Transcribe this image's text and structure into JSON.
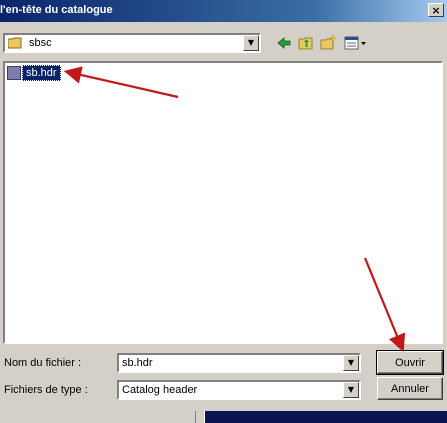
{
  "window": {
    "title": "l'en-tête du catalogue",
    "close_glyph": "×"
  },
  "lookin": {
    "value": "sbsc",
    "arrow_glyph": "▼"
  },
  "toolbar": {
    "icons": [
      "back-icon",
      "up-folder-icon",
      "new-folder-icon",
      "view-menu-icon"
    ]
  },
  "filelist": {
    "items": [
      {
        "name": "sb.hdr",
        "selected": true
      }
    ]
  },
  "filename": {
    "label": "Nom du fichier :",
    "value": "sb.hdr"
  },
  "filetype": {
    "label": "Fichiers de type :",
    "value": "Catalog header"
  },
  "buttons": {
    "open": "Ouvrir",
    "cancel": "Annuler"
  },
  "colors": {
    "selection": "#0a246a",
    "arrow": "#c0181b",
    "titlebar": "#0a246a"
  }
}
